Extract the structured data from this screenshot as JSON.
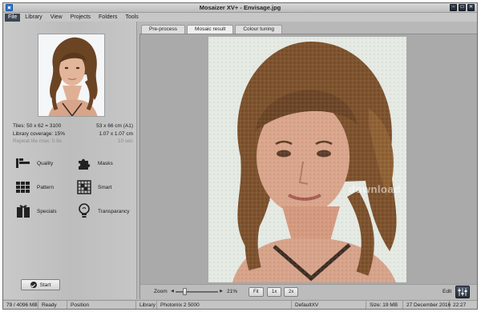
{
  "window": {
    "title": "Mosaizer XV+  - Envisage.jpg"
  },
  "window_controls": [
    "−",
    "□",
    "✕"
  ],
  "menu": [
    {
      "label": "File",
      "active": true
    },
    {
      "label": "Library",
      "active": false
    },
    {
      "label": "View",
      "active": false
    },
    {
      "label": "Projects",
      "active": false
    },
    {
      "label": "Folders",
      "active": false
    },
    {
      "label": "Tools",
      "active": false
    }
  ],
  "stats": [
    {
      "left": "Tiles: 50 x 62 = 3100",
      "right": "53 x 66 cm  (A1)"
    },
    {
      "left": "Library coverage: 15%",
      "right": "1.07 x 1.07 cm"
    },
    {
      "left": "Repeat tile max: 0.6x",
      "right": "10 sec"
    }
  ],
  "tools": [
    {
      "label": "Quality",
      "icon": "quality-icon"
    },
    {
      "label": "Masks",
      "icon": "masks-icon"
    },
    {
      "label": "Pattern",
      "icon": "pattern-icon"
    },
    {
      "label": "Smart",
      "icon": "smart-icon"
    },
    {
      "label": "Specials",
      "icon": "specials-icon"
    },
    {
      "label": "Transparancy",
      "icon": "transparency-icon"
    }
  ],
  "start_button": {
    "label": "Start"
  },
  "tabs": [
    {
      "label": "Pre-process",
      "active": false
    },
    {
      "label": "Mosaic result",
      "active": true
    },
    {
      "label": "Colour tuning",
      "active": false
    }
  ],
  "watermark": "download",
  "zoom": {
    "label": "Zoom",
    "value": "21%",
    "level": 0.21
  },
  "zoom_buttons": [
    "Fit",
    "1x",
    "2x"
  ],
  "edit": {
    "label": "Edit"
  },
  "status": {
    "memory": "79 / 4096 MB",
    "state": "Ready",
    "position": "Position",
    "library_label": "Library",
    "library": "Photomix 2 5000",
    "preset": "DefaultXV",
    "size": "Size:  19 MB",
    "date": "27 December 2016",
    "time": "22:27"
  },
  "colors": {
    "active_menu": "#3d4654",
    "app_icon": "#2f7bd8",
    "panel": "#bdbdbd"
  }
}
